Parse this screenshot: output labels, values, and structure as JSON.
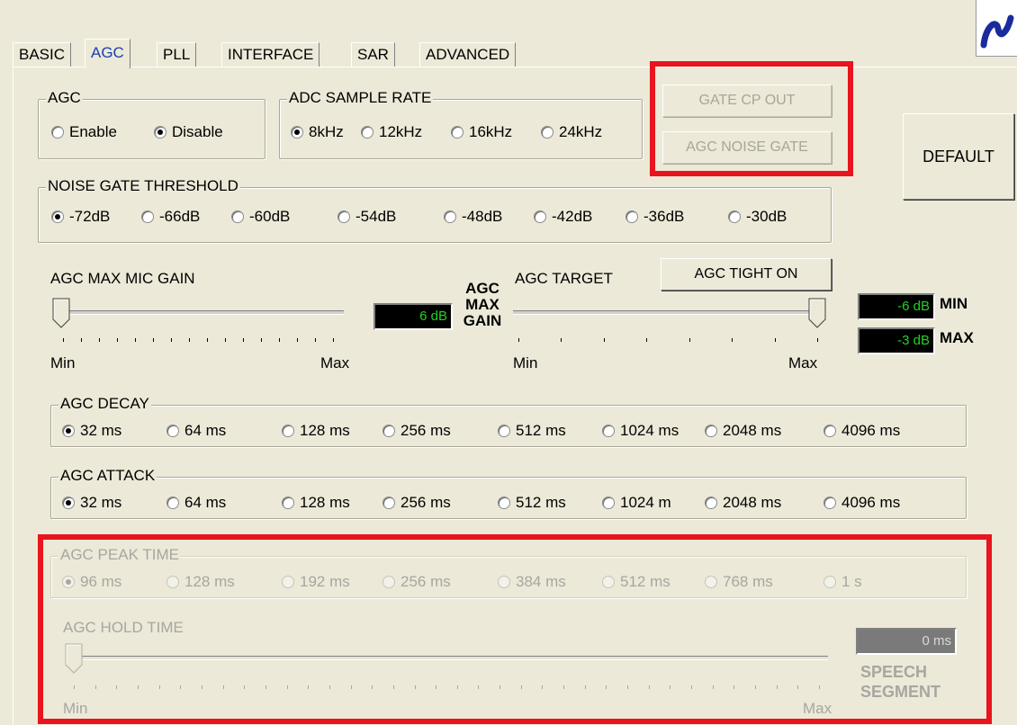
{
  "tabs": [
    "BASIC",
    "AGC",
    "PLL",
    "INTERFACE",
    "SAR",
    "ADVANCED"
  ],
  "active_tab": "AGC",
  "agc_group": {
    "title": "AGC",
    "options": [
      "Enable",
      "Disable"
    ],
    "selected": "Disable"
  },
  "adc_group": {
    "title": "ADC SAMPLE RATE",
    "options": [
      "8kHz",
      "12kHz",
      "16kHz",
      "24kHz"
    ],
    "selected": "8kHz"
  },
  "buttons": {
    "gate_cp_out": "GATE CP OUT",
    "agc_noise_gate": "AGC NOISE GATE",
    "default": "DEFAULT",
    "agc_tight_on": "AGC TIGHT ON"
  },
  "noise_gate": {
    "title": "NOISE GATE THRESHOLD",
    "options": [
      "-72dB",
      "-66dB",
      "-60dB",
      "-54dB",
      "-48dB",
      "-42dB",
      "-36dB",
      "-30dB"
    ],
    "selected": "-72dB"
  },
  "max_mic_gain": {
    "label": "AGC MAX MIC GAIN",
    "min": "Min",
    "max": "Max",
    "value": "6 dB",
    "caption_line1": "AGC",
    "caption_line2": "MAX",
    "caption_line3": "GAIN",
    "level": 0
  },
  "agc_target": {
    "label": "AGC TARGET",
    "min": "Min",
    "max": "Max",
    "value_min": "-6 dB",
    "value_max": "-3 dB",
    "label_min": "MIN",
    "label_max": "MAX",
    "level": 1
  },
  "decay": {
    "title": "AGC DECAY",
    "options": [
      "32 ms",
      "64 ms",
      "128 ms",
      "256 ms",
      "512 ms",
      "1024 ms",
      "2048 ms",
      "4096 ms"
    ],
    "selected": "32 ms"
  },
  "attack": {
    "title": "AGC ATTACK",
    "options": [
      "32 ms",
      "64 ms",
      "128 ms",
      "256 ms",
      "512 ms",
      "1024 m",
      "2048 ms",
      "4096 ms"
    ],
    "selected": "32 ms"
  },
  "peak_time": {
    "title": "AGC PEAK TIME",
    "options": [
      "96 ms",
      "128 ms",
      "192 ms",
      "256 ms",
      "384 ms",
      "512 ms",
      "768 ms",
      "1 s"
    ],
    "selected": "96 ms"
  },
  "hold_time": {
    "label": "AGC HOLD TIME",
    "min": "Min",
    "max": "Max",
    "value": "0 ms",
    "caption_line1": "SPEECH",
    "caption_line2": "SEGMENT",
    "level": 0
  },
  "colors": {
    "highlight_box": "#e8141e",
    "lcd_text": "#1fd41f",
    "logo": "#1a2c9c"
  }
}
